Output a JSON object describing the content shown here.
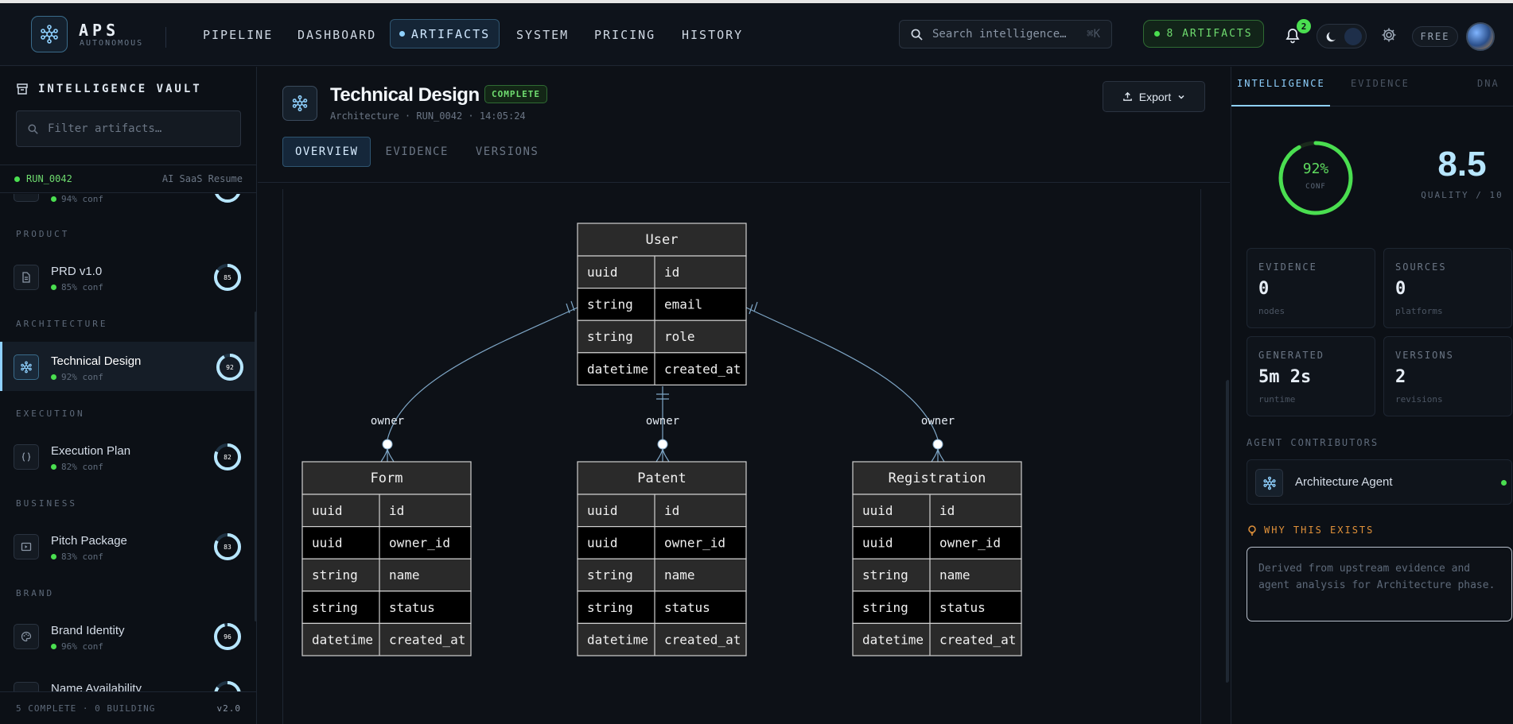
{
  "topbar": {
    "brand_title": "APS",
    "brand_subtitle": "AUTONOMOUS",
    "nav": [
      "PIPELINE",
      "DASHBOARD",
      "ARTIFACTS",
      "SYSTEM",
      "PRICING",
      "HISTORY"
    ],
    "active_nav": "ARTIFACTS",
    "search_placeholder": "Search intelligence…",
    "search_shortcut": "⌘K",
    "artifacts_count": "8 ARTIFACTS",
    "notification_count": "2",
    "plan": "FREE",
    "icons": [
      "logo-network-icon",
      "search-icon",
      "bell-icon",
      "moon-icon",
      "gear-icon",
      "avatar"
    ]
  },
  "sidebar": {
    "title": "INTELLIGENCE VAULT",
    "filter_placeholder": "Filter artifacts…",
    "run_id": "RUN_0042",
    "run_project": "AI SaaS Resume",
    "partial_item_conf": "94% conf",
    "sections": {
      "product": "PRODUCT",
      "architecture": "ARCHITECTURE",
      "execution": "EXECUTION",
      "business": "BUSINESS",
      "brand": "BRAND"
    },
    "items": [
      {
        "name": "PRD v1.0",
        "conf": "85% conf",
        "score": "85",
        "icon": "document-icon"
      },
      {
        "name": "Technical Design",
        "conf": "92% conf",
        "score": "92",
        "icon": "network-icon",
        "active": true
      },
      {
        "name": "Execution Plan",
        "conf": "82% conf",
        "score": "82",
        "icon": "braces-icon"
      },
      {
        "name": "Pitch Package",
        "conf": "83% conf",
        "score": "83",
        "icon": "presentation-icon"
      },
      {
        "name": "Brand Identity",
        "conf": "96% conf",
        "score": "96",
        "icon": "palette-icon"
      },
      {
        "name": "Name Availability",
        "conf": "",
        "score": "",
        "icon": "search-icon"
      }
    ],
    "footer_status": "5 COMPLETE · 0 BUILDING",
    "footer_version": "v2.0"
  },
  "main": {
    "title": "Technical Design",
    "status_badge": "COMPLETE",
    "meta": "Architecture · RUN_0042 · 14:05:24",
    "export_label": "Export",
    "tabs": [
      "OVERVIEW",
      "EVIDENCE",
      "VERSIONS"
    ],
    "active_tab": "OVERVIEW"
  },
  "diagram": {
    "entities": {
      "user": {
        "name": "User",
        "rows": [
          [
            "uuid",
            "id"
          ],
          [
            "string",
            "email"
          ],
          [
            "string",
            "role"
          ],
          [
            "datetime",
            "created_at"
          ]
        ]
      },
      "form": {
        "name": "Form",
        "rows": [
          [
            "uuid",
            "id"
          ],
          [
            "uuid",
            "owner_id"
          ],
          [
            "string",
            "name"
          ],
          [
            "string",
            "status"
          ],
          [
            "datetime",
            "created_at"
          ]
        ]
      },
      "patent": {
        "name": "Patent",
        "rows": [
          [
            "uuid",
            "id"
          ],
          [
            "uuid",
            "owner_id"
          ],
          [
            "string",
            "name"
          ],
          [
            "string",
            "status"
          ],
          [
            "datetime",
            "created_at"
          ]
        ]
      },
      "registration": {
        "name": "Registration",
        "rows": [
          [
            "uuid",
            "id"
          ],
          [
            "uuid",
            "owner_id"
          ],
          [
            "string",
            "name"
          ],
          [
            "string",
            "status"
          ],
          [
            "datetime",
            "created_at"
          ]
        ]
      }
    },
    "relationship_label": "owner"
  },
  "right_panel": {
    "tabs": [
      "INTELLIGENCE",
      "EVIDENCE",
      "DNA"
    ],
    "active_tab": "INTELLIGENCE",
    "confidence_percent": 92,
    "confidence_text": "92%",
    "confidence_label": "CONF",
    "quality_value": "8.5",
    "quality_label": "QUALITY / 10",
    "stats": [
      {
        "label": "EVIDENCE",
        "value": "0",
        "sub": "nodes"
      },
      {
        "label": "SOURCES",
        "value": "0",
        "sub": "platforms"
      },
      {
        "label": "GENERATED",
        "value": "5m 2s",
        "sub": "runtime"
      },
      {
        "label": "VERSIONS",
        "value": "2",
        "sub": "revisions"
      }
    ],
    "contributors_title": "AGENT CONTRIBUTORS",
    "contributor_name": "Architecture Agent",
    "why_title": "WHY THIS EXISTS",
    "why_text": "Derived from upstream evidence and agent analysis for Architecture phase."
  },
  "colors": {
    "accent": "#8fd1ff",
    "success": "#4ade50",
    "warning": "#e0913a",
    "background": "#0d1117"
  }
}
